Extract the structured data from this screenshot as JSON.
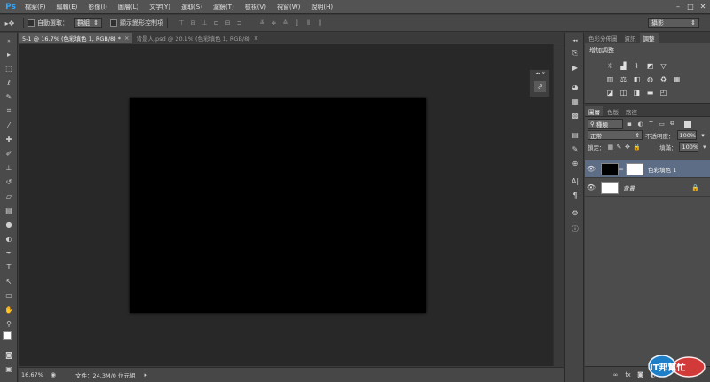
{
  "app": {
    "logo": "Ps",
    "menu": [
      "檔案(F)",
      "編輯(E)",
      "影像(I)",
      "圖層(L)",
      "文字(Y)",
      "選取(S)",
      "濾鏡(T)",
      "檢視(V)",
      "視窗(W)",
      "說明(H)"
    ],
    "window_controls": [
      "minimize-icon",
      "maximize-icon",
      "close-icon"
    ]
  },
  "options": {
    "auto_select_label": "自動選取：",
    "auto_select_value": "群組",
    "show_transform_label": "顯示變形控制項",
    "workspace": "攝影"
  },
  "tabs": [
    {
      "label": "5-1 @ 16.7% (色彩填色 1, RGB/8) *",
      "active": true
    },
    {
      "label": "背景人.psd @ 20.1% (色彩填色 1, RGB/8)",
      "active": false
    }
  ],
  "status": {
    "zoom": "16.67%",
    "doc_info": "文件：24.3M/0 位元組"
  },
  "adjustments": {
    "tabs": [
      "色彩分佈圖",
      "資訊",
      "調整"
    ],
    "active_tab": 2,
    "title": "增加調整"
  },
  "layers": {
    "tabs": [
      "圖層",
      "色版",
      "路徑"
    ],
    "filter_kind": "種類",
    "blend_mode": "正常",
    "opacity_label": "不透明度：",
    "opacity_value": "100%",
    "lock_label": "鎖定：",
    "fill_label": "填滿：",
    "fill_value": "100%",
    "items": [
      {
        "name": "色彩填色 1",
        "thumb_color": "#000000",
        "selected": true
      },
      {
        "name": "背景",
        "thumb_color": "#ffffff",
        "selected": false
      }
    ]
  },
  "colors": {
    "foreground": "#ffffff",
    "background": "#000000",
    "selected_layer": "#5d6d86",
    "canvas": "#000000"
  },
  "watermark": {
    "text": "IT邦幫忙"
  }
}
